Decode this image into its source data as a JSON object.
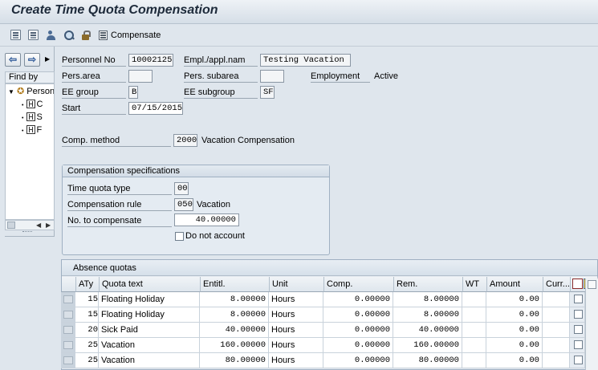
{
  "window": {
    "title": "Create Time Quota Compensation"
  },
  "toolbar": {
    "icons": [
      "save-icon",
      "form-icon",
      "person-icon",
      "search-icon",
      "unlock-icon"
    ],
    "compensate_label": "Compensate"
  },
  "nav": {
    "find_by": "Find by",
    "tree": {
      "root": "Person",
      "children": [
        "C",
        "S",
        "F"
      ]
    }
  },
  "header": {
    "personnel_no_label": "Personnel No",
    "personnel_no": "10002125",
    "empl_name_label": "Empl./appl.nam",
    "empl_name": "Testing Vacation",
    "pers_area_label": "Pers.area",
    "pers_area": "",
    "pers_subarea_label": "Pers. subarea",
    "pers_subarea": "",
    "employment_label": "Employment",
    "employment": "Active",
    "ee_group_label": "EE group",
    "ee_group": "B",
    "ee_subgroup_label": "EE subgroup",
    "ee_subgroup": "SF",
    "start_label": "Start",
    "start": "07/15/2015",
    "comp_method_label": "Comp. method",
    "comp_method_code": "2000",
    "comp_method_text": "Vacation Compensation"
  },
  "comp_spec": {
    "title": "Compensation specifications",
    "time_quota_type_label": "Time quota type",
    "time_quota_type": "00",
    "comp_rule_label": "Compensation rule",
    "comp_rule_code": "050",
    "comp_rule_text": "Vacation",
    "no_to_compensate_label": "No. to compensate",
    "no_to_compensate": "40.00000",
    "do_not_account_label": "Do not account",
    "do_not_account": false
  },
  "absence_quotas": {
    "title": "Absence quotas",
    "columns": [
      "ATy",
      "Quota text",
      "Entitl.",
      "Unit",
      "Comp.",
      "Rem.",
      "WT",
      "Amount",
      "Curr..."
    ],
    "rows": [
      {
        "aty": "15",
        "quota_text": "Floating Holiday",
        "entitl": "8.00000",
        "unit": "Hours",
        "comp": "0.00000",
        "rem": "8.00000",
        "wt": "",
        "amount": "0.00",
        "curr": ""
      },
      {
        "aty": "15",
        "quota_text": "Floating Holiday",
        "entitl": "8.00000",
        "unit": "Hours",
        "comp": "0.00000",
        "rem": "8.00000",
        "wt": "",
        "amount": "0.00",
        "curr": ""
      },
      {
        "aty": "20",
        "quota_text": "Sick Paid",
        "entitl": "40.00000",
        "unit": "Hours",
        "comp": "0.00000",
        "rem": "40.00000",
        "wt": "",
        "amount": "0.00",
        "curr": ""
      },
      {
        "aty": "25",
        "quota_text": "Vacation",
        "entitl": "160.00000",
        "unit": "Hours",
        "comp": "0.00000",
        "rem": "160.00000",
        "wt": "",
        "amount": "0.00",
        "curr": ""
      },
      {
        "aty": "25",
        "quota_text": "Vacation",
        "entitl": "80.00000",
        "unit": "Hours",
        "comp": "0.00000",
        "rem": "80.00000",
        "wt": "",
        "amount": "0.00",
        "curr": ""
      }
    ]
  },
  "colors": {
    "background": "#dfe6ed",
    "title_text": "#1d2a3a",
    "accent": "#2b5797"
  }
}
